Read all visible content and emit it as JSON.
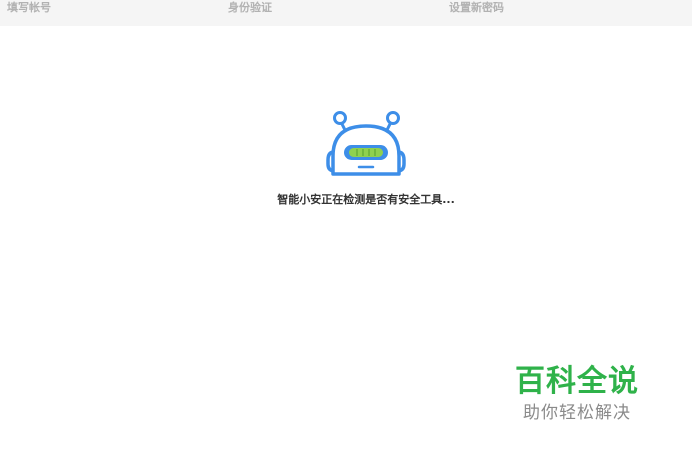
{
  "steps": {
    "step1": "填写帐号",
    "step2": "身份验证",
    "step3": "设置新密码"
  },
  "status": {
    "message": "智能小安正在检测是否有安全工具..."
  },
  "watermark": {
    "title": "百科全说",
    "subtitle": "助你轻松解决"
  },
  "icons": {
    "robot": "robot-icon"
  },
  "colors": {
    "robot_blue": "#3d8ee8",
    "robot_green": "#8fd14f",
    "watermark_green": "#2fb24a"
  }
}
